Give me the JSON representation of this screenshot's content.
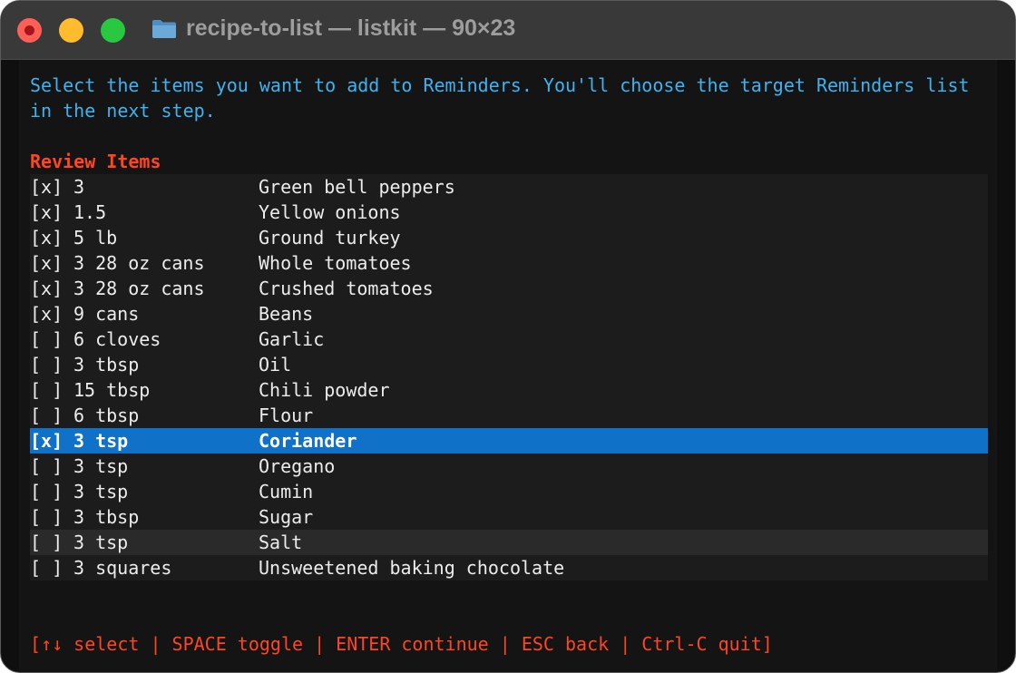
{
  "window": {
    "title": "recipe-to-list — listkit — 90×23"
  },
  "terminal": {
    "intro_line1": "Select the items you want to add to Reminders. You'll choose the target Reminders list",
    "intro_line2": "in the next step.",
    "heading": "Review Items",
    "items": [
      {
        "checkbox": "[x]",
        "qty": "3",
        "name": "Green bell peppers"
      },
      {
        "checkbox": "[x]",
        "qty": "1.5",
        "name": "Yellow onions"
      },
      {
        "checkbox": "[x]",
        "qty": "5 lb",
        "name": "Ground turkey"
      },
      {
        "checkbox": "[x]",
        "qty": "3 28 oz cans",
        "name": "Whole tomatoes"
      },
      {
        "checkbox": "[x]",
        "qty": "3 28 oz cans",
        "name": "Crushed tomatoes"
      },
      {
        "checkbox": "[x]",
        "qty": "9 cans",
        "name": "Beans"
      },
      {
        "checkbox": "[ ]",
        "qty": "6 cloves",
        "name": "Garlic"
      },
      {
        "checkbox": "[ ]",
        "qty": "3 tbsp",
        "name": "Oil"
      },
      {
        "checkbox": "[ ]",
        "qty": "15 tbsp",
        "name": "Chili powder"
      },
      {
        "checkbox": "[ ]",
        "qty": "6 tbsp",
        "name": "Flour"
      },
      {
        "checkbox": "[x]",
        "qty": "3 tsp",
        "name": "Coriander"
      },
      {
        "checkbox": "[ ]",
        "qty": "3 tsp",
        "name": "Oregano"
      },
      {
        "checkbox": "[ ]",
        "qty": "3 tsp",
        "name": "Cumin"
      },
      {
        "checkbox": "[ ]",
        "qty": "3 tbsp",
        "name": "Sugar"
      },
      {
        "checkbox": "[ ]",
        "qty": "3 tsp",
        "name": "Salt"
      },
      {
        "checkbox": "[ ]",
        "qty": "3 squares",
        "name": "Unsweetened baking chocolate"
      }
    ],
    "help": "[↑↓ select | SPACE toggle | ENTER continue | ESC back | Ctrl-C quit]"
  },
  "colors": {
    "intro": "#3fb2f0",
    "heading": "#ff4522",
    "selection": "#1071c9",
    "help": "#ff4522"
  },
  "icons": {
    "title_icon": "folder-icon"
  }
}
